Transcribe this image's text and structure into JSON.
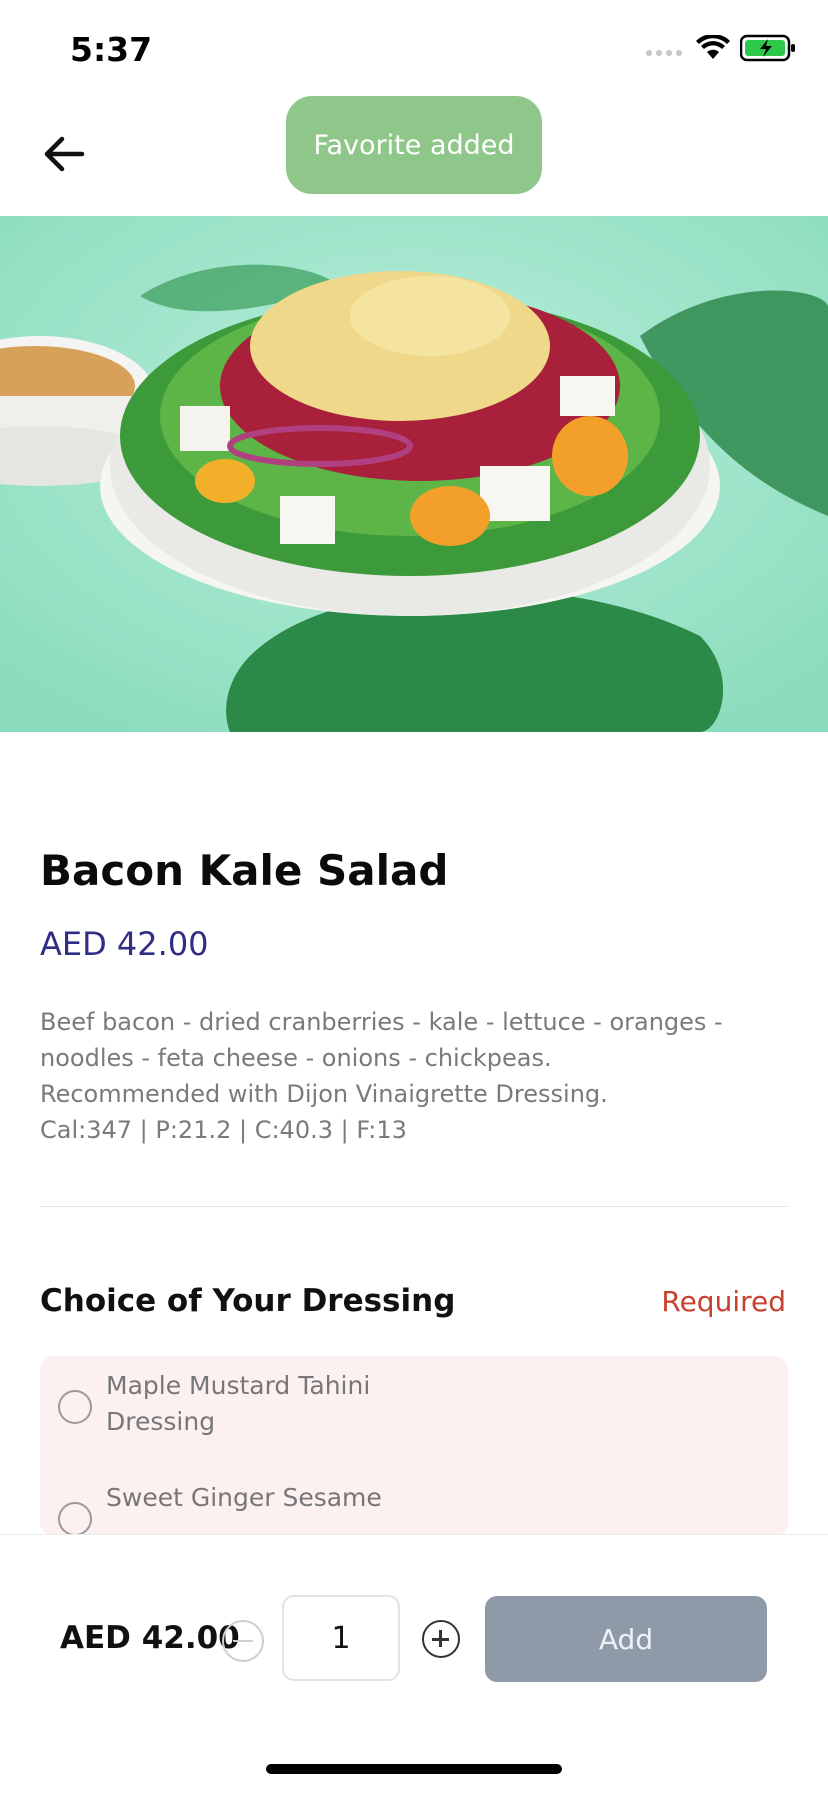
{
  "status_bar": {
    "time": "5:37",
    "icons": [
      "signal-icon",
      "wifi-icon",
      "battery-charging-icon"
    ]
  },
  "toast": {
    "text": "Favorite added",
    "color": "#8fc78a"
  },
  "product": {
    "name": "Bacon Kale Salad",
    "price": "AED 42.00",
    "description_lines": [
      "Beef bacon - dried cranberries - kale - lettuce - oranges -",
      "noodles - feta cheese - onions - chickpeas.",
      "Recommended with Dijon Vinaigrette Dressing.",
      "Cal:347 | P:21.2 | C:40.3 | F:13"
    ],
    "image_semantic": "salad-photo"
  },
  "dressing": {
    "title": "Choice of Your Dressing",
    "required_label": "Required",
    "options": [
      {
        "label_lines": [
          "Maple Mustard Tahini",
          "Dressing"
        ],
        "selected": false
      },
      {
        "label_lines": [
          "Sweet Ginger Sesame"
        ],
        "selected": false
      }
    ]
  },
  "footer": {
    "total": "AED 42.00",
    "quantity": "1",
    "add_label": "Add"
  },
  "colors": {
    "price": "#2f2d84",
    "required": "#c8402e",
    "options_bg": "#fdf0f0",
    "add_button": "#8e9aa7"
  }
}
